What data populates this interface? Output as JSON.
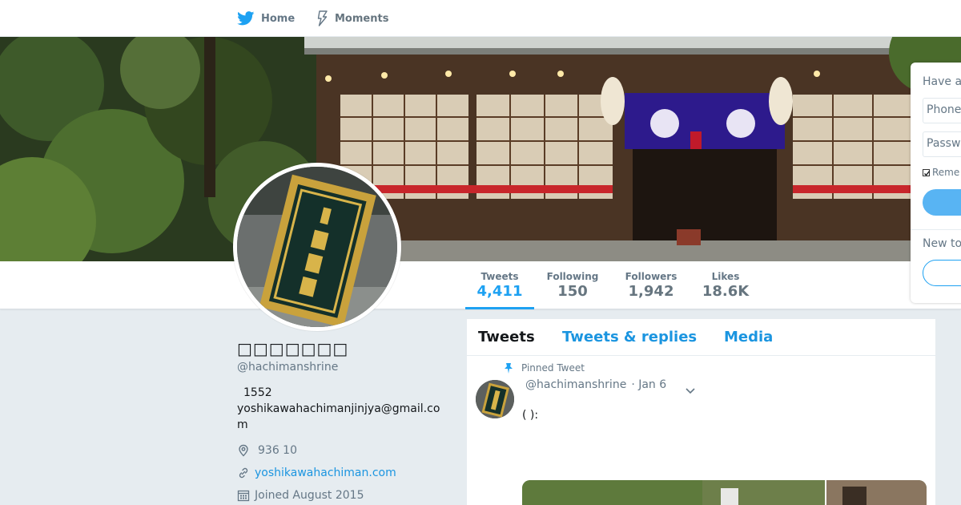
{
  "nav": {
    "home_label": "Home",
    "moments_label": "Moments",
    "brand_color": "#1da1f2"
  },
  "stats": {
    "tweets": {
      "label": "Tweets",
      "value": "4,411"
    },
    "following": {
      "label": "Following",
      "value": "150"
    },
    "followers": {
      "label": "Followers",
      "value": "1,942"
    },
    "likes": {
      "label": "Likes",
      "value": "18.6K"
    }
  },
  "profile": {
    "fullname": "□□□□□□□",
    "screen_name": "@hachimanshrine",
    "bio_number": "1552",
    "bio_email": "yoshikawahachimanjinjya@gmail.com",
    "location": "936 10",
    "url": "yoshikawahachiman.com",
    "joined": "Joined August 2015"
  },
  "timeline": {
    "tabs": [
      "Tweets",
      "Tweets & replies",
      "Media"
    ],
    "pinned_label": "Pinned Tweet",
    "tweet": {
      "screen_name": "@hachimanshrine",
      "time": "· Jan 6",
      "text": "( ):"
    }
  },
  "login": {
    "heading": "Have a",
    "phone_placeholder": "Phone",
    "password_placeholder": "Passw",
    "remember_label": "Reme",
    "new_to_label": "New to"
  },
  "colors": {
    "accent": "#1da1f2",
    "link": "#1b95e0",
    "background": "#e6ecf0"
  }
}
